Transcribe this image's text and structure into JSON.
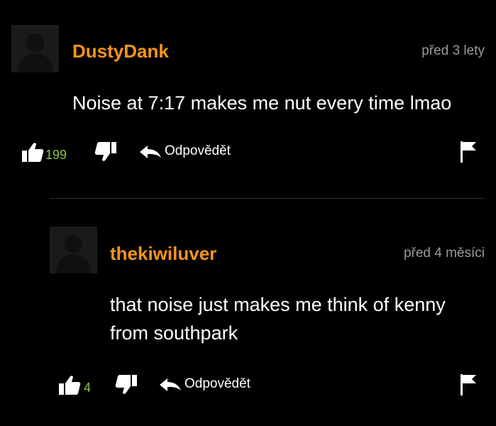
{
  "comments": [
    {
      "username": "DustyDank",
      "timestamp": "před 3 lety",
      "text": "Noise at 7:17 makes me nut every time lmao",
      "likes": "199",
      "reply_label": "Odpovědět"
    },
    {
      "username": "thekiwiluver",
      "timestamp": "před 4 měsíci",
      "text": "that noise just makes me think of kenny from southpark",
      "likes": "4",
      "reply_label": "Odpovědět"
    }
  ],
  "colors": {
    "username": "#f7941d",
    "like_count": "#8cc63f",
    "timestamp": "#9a9a9a",
    "background": "#000000"
  },
  "icons": [
    "default-avatar-icon",
    "thumbs-up-icon",
    "thumbs-down-icon",
    "reply-arrow-icon",
    "flag-icon"
  ]
}
